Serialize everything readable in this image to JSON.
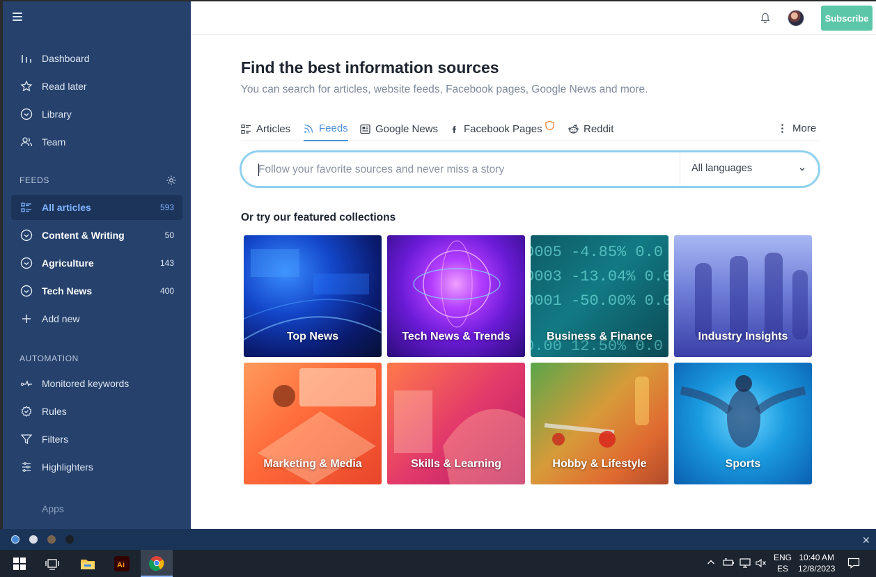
{
  "sidebar": {
    "nav": [
      {
        "label": "Dashboard",
        "icon": "chart-bars-icon"
      },
      {
        "label": "Read later",
        "icon": "star-icon"
      },
      {
        "label": "Library",
        "icon": "circle-check-icon"
      },
      {
        "label": "Team",
        "icon": "people-icon"
      }
    ],
    "feeds_title": "FEEDS",
    "feeds": [
      {
        "label": "All articles",
        "count": "593",
        "icon": "list-icon"
      },
      {
        "label": "Content & Writing",
        "count": "50",
        "icon": "circle-check-icon"
      },
      {
        "label": "Agriculture",
        "count": "143",
        "icon": "circle-check-icon"
      },
      {
        "label": "Tech News",
        "count": "400",
        "icon": "circle-check-icon"
      }
    ],
    "add_new": "Add new",
    "automation_title": "AUTOMATION",
    "automation": [
      {
        "label": "Monitored keywords",
        "icon": "pulse-icon"
      },
      {
        "label": "Rules",
        "icon": "gear-check-icon"
      },
      {
        "label": "Filters",
        "icon": "funnel-icon"
      },
      {
        "label": "Highlighters",
        "icon": "highlighter-icon"
      }
    ],
    "apps": "Apps"
  },
  "header": {
    "subscribe": "Subscribe"
  },
  "main": {
    "title": "Find the best information sources",
    "subtitle": "You can search for articles, website feeds, Facebook pages, Google News and more.",
    "tabs": [
      {
        "label": "Articles"
      },
      {
        "label": "Feeds"
      },
      {
        "label": "Google News"
      },
      {
        "label": "Facebook Pages"
      },
      {
        "label": "Reddit"
      }
    ],
    "more": "More",
    "search_placeholder": "Follow your favorite sources and never miss a story",
    "language": "All languages",
    "featured_title": "Or try our featured collections",
    "collections": [
      {
        "label": "Top News"
      },
      {
        "label": "Tech News & Trends"
      },
      {
        "label": "Business & Finance"
      },
      {
        "label": "Industry Insights"
      },
      {
        "label": "Marketing & Media"
      },
      {
        "label": "Skills & Learning"
      },
      {
        "label": "Hobby & Lifestyle"
      },
      {
        "label": "Sports"
      }
    ]
  },
  "taskbar": {
    "lang_top": "ENG",
    "lang_bottom": "ES",
    "time": "10:40 AM",
    "date": "12/8/2023"
  },
  "colors": {
    "sidebar_bg": "#25416c",
    "accent": "#4b8fd9",
    "subscribe": "#5cc6a8"
  }
}
